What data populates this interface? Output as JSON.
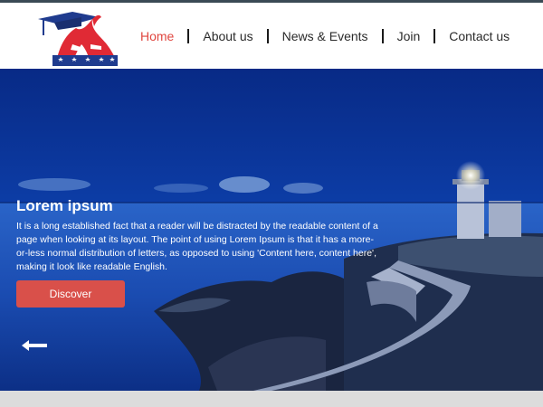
{
  "nav": {
    "items": [
      {
        "label": "Home",
        "active": true
      },
      {
        "label": "About us"
      },
      {
        "label": "News & Events"
      },
      {
        "label": "Join"
      },
      {
        "label": "Contact us"
      }
    ]
  },
  "hero": {
    "title": "Lorem ipsum",
    "text": "It is a long established fact that a reader will be distracted by the readable content of a page when looking at its layout. The point of using Lorem Ipsum is that it has a more-or-less normal distribution of letters, as opposed to using 'Content here, content here', making it look like readable English.",
    "button_label": "Discover"
  },
  "icons": {
    "logo": "graduation-cap-logo-icon",
    "prev": "arrow-left-icon"
  },
  "colors": {
    "accent": "#e0463f",
    "button": "#d9504a",
    "header_bg": "#ffffff",
    "hero_sky": "#0b2f8a"
  }
}
